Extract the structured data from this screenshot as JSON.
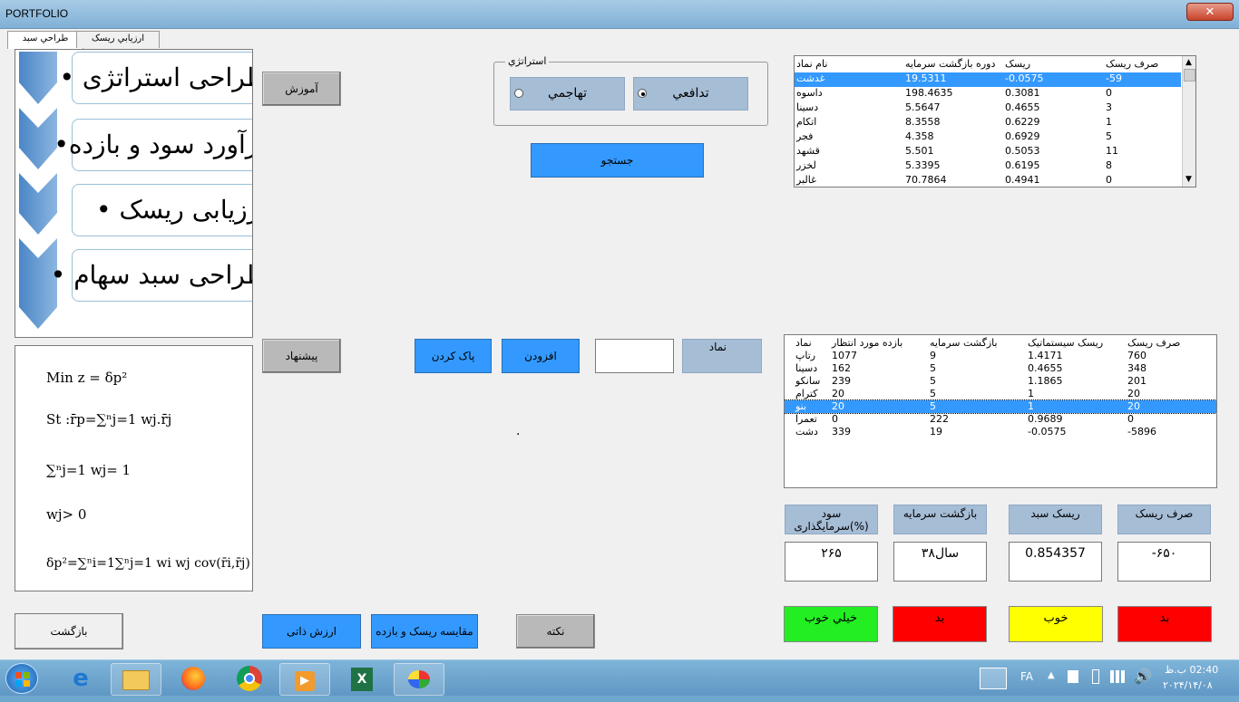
{
  "window": {
    "title": "PORTFOLIO",
    "close": "✕"
  },
  "tabs": [
    {
      "label": "طراحي سبد"
    },
    {
      "label": "ارزيابي ريسک"
    }
  ],
  "steps": [
    {
      "label": "طراحی استراتژی •"
    },
    {
      "label": "برآورد سود و بازده•"
    },
    {
      "label": "ارزیابی ریسک •"
    },
    {
      "label": "طراحی سبد سهام •"
    }
  ],
  "formulas": {
    "f1": "Min z = δp²",
    "f2": "St :r̄p=∑ⁿj=1 wj.r̄j",
    "f3": "∑ⁿj=1 wj= 1",
    "f4": "wj> 0",
    "f5": "δp²=∑ⁿi=1∑ⁿj=1 wi wj cov(r̄i,r̄j)"
  },
  "buttons": {
    "amoozesh": "آموزش",
    "search": "جستجو",
    "pishnahad": "پيشنهاد",
    "clear": "پاک کردن",
    "add": "افزودن",
    "back": "بازگشت",
    "intrinsic": "ارزش ذاتی",
    "compare": "مقايسه ريسک و بازده",
    "note": "نکته"
  },
  "strategy": {
    "legend": "استراتژي",
    "option_aggressive": "تهاجمي",
    "option_defensive": "تدافعي",
    "selected": "تدافعي"
  },
  "symbol_label": "نماد",
  "symbol_input": "",
  "dot": ".",
  "top_list": {
    "headers": [
      "نام نماد",
      "دوره بازگشت سرمايه",
      "ريسک",
      "صرف ريسک"
    ],
    "rows": [
      [
        "غدشت",
        "19.5311",
        "-0.0575",
        "-59"
      ],
      [
        "داسوه",
        "198.4635",
        "0.3081",
        "0"
      ],
      [
        "دسينا",
        "5.5647",
        "0.4655",
        "3"
      ],
      [
        "اتکام",
        "8.3558",
        "0.6229",
        "1"
      ],
      [
        "فجر",
        "4.358",
        "0.6929",
        "5"
      ],
      [
        "قشهد",
        "5.501",
        "0.5053",
        "11"
      ],
      [
        "لخزر",
        "5.3395",
        "0.6195",
        "8"
      ],
      [
        "غالبر",
        "70.7864",
        "0.4941",
        "0"
      ]
    ],
    "selected_index": 0
  },
  "basket_list": {
    "headers": [
      "نماد",
      "بازده مورد انتظار",
      "بازگشت سرمايه",
      "ريسک سيستماتيک",
      "صرف ريسک"
    ],
    "rows": [
      [
        "رتاپ",
        "1077",
        "9",
        "1.4171",
        "760"
      ],
      [
        "دسينا",
        "162",
        "5",
        "0.4655",
        "348"
      ],
      [
        "سانکو",
        "239",
        "5",
        "1.1865",
        "201"
      ],
      [
        "کترام",
        "20",
        "5",
        "1",
        "20"
      ],
      [
        "بنو",
        "20",
        "5",
        "1",
        "20"
      ],
      [
        "تعمرا",
        "0",
        "222",
        "0.9689",
        "0"
      ],
      [
        "دشت",
        "339",
        "19",
        "-0.0575",
        "-5896"
      ]
    ],
    "selected_index": 4
  },
  "summary": {
    "labels": {
      "profit": "سود سرمايگذاری(%)",
      "payback": "بازگشت سرمايه",
      "risk": "ريسک سبد",
      "premium": "صرف ريسک"
    },
    "values": {
      "profit": "۲۶۵",
      "payback": "۳۸سال",
      "risk": "0.854357",
      "premium": "-۶۵۰"
    },
    "status": {
      "profit": "خيلي خوب",
      "payback": "بد",
      "risk": "خوب",
      "premium": "بد"
    },
    "status_colors": {
      "profit": "#22ee22",
      "payback": "#ff0000",
      "risk": "#ffff00",
      "premium": "#ff0000"
    }
  },
  "taskbar": {
    "language": "FA",
    "time": "02:40 ب.ظ",
    "date": "۲۰۲۴/۱۴/۰۸",
    "apps": [
      "start-orb",
      "internet-explorer",
      "file-explorer",
      "firefox",
      "chrome",
      "media-player",
      "excel",
      "paint"
    ]
  }
}
